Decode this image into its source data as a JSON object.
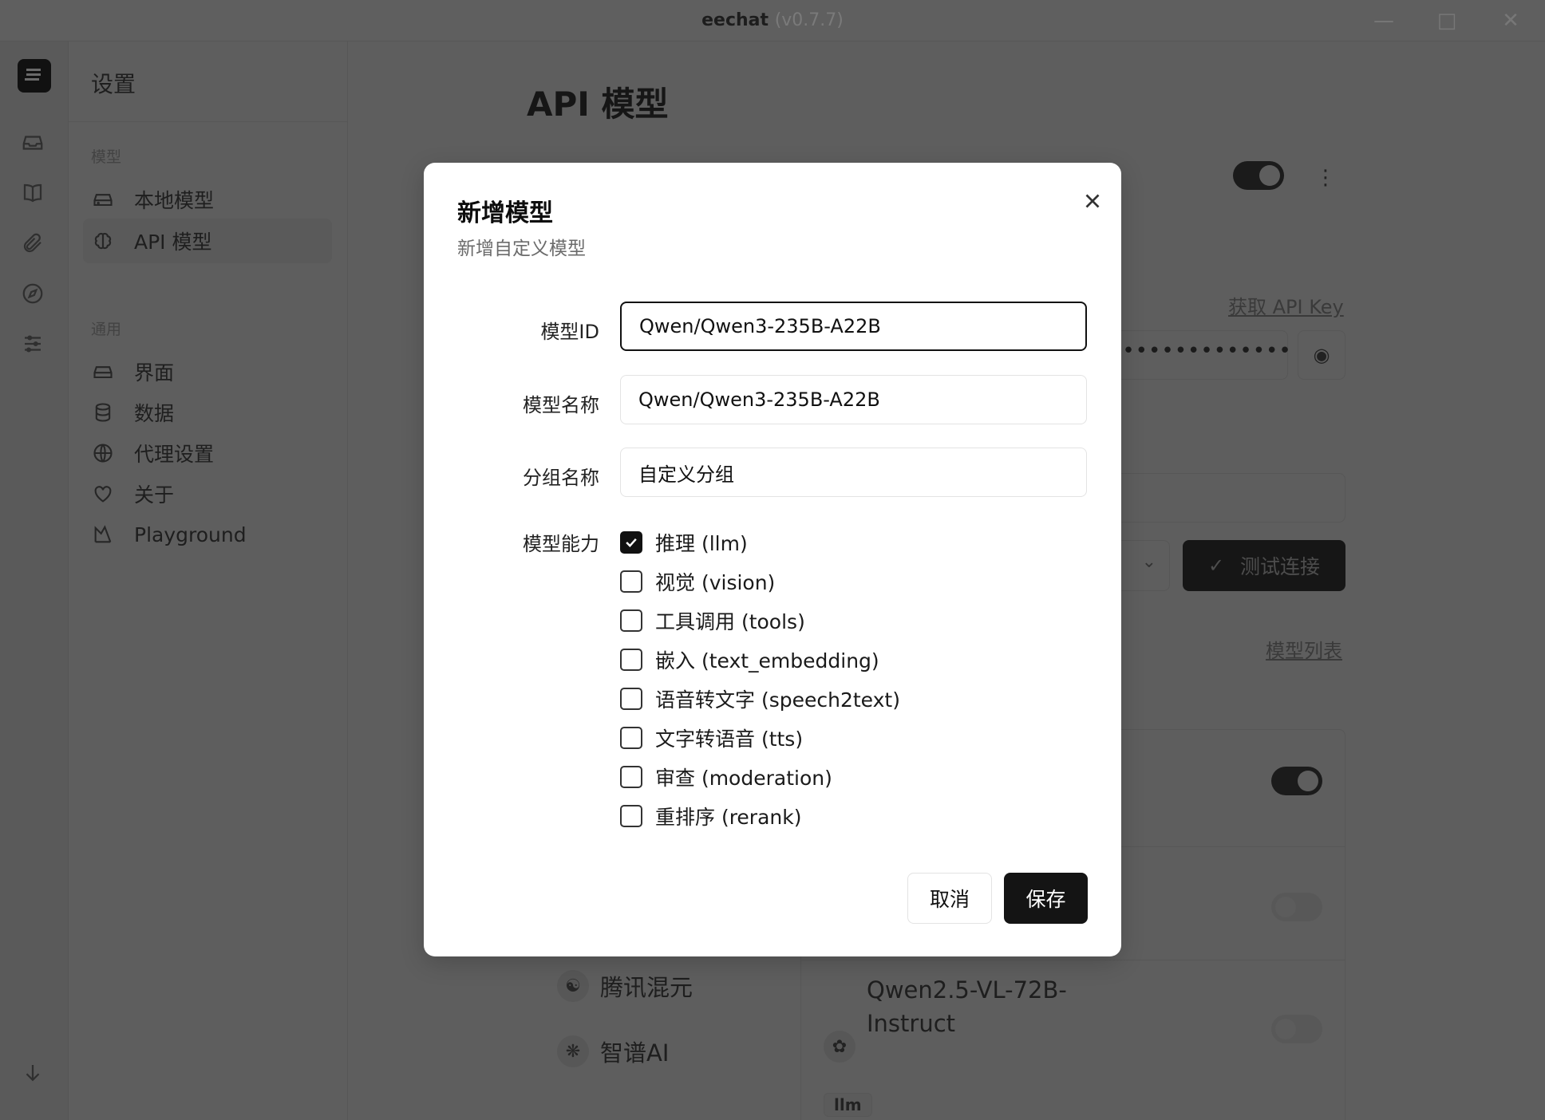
{
  "window": {
    "app_name": "eechat",
    "version": "(v0.7.7)"
  },
  "sidebar": {
    "title": "设置",
    "sections": [
      {
        "label": "模型",
        "items": [
          {
            "label": "本地模型",
            "icon": "drive-icon"
          },
          {
            "label": "API 模型",
            "icon": "brain-icon",
            "active": true
          }
        ]
      },
      {
        "label": "通用",
        "items": [
          {
            "label": "界面",
            "icon": "drive-icon"
          },
          {
            "label": "数据",
            "icon": "database-icon"
          },
          {
            "label": "代理设置",
            "icon": "globe-icon"
          },
          {
            "label": "关于",
            "icon": "heart-icon"
          },
          {
            "label": "Playground",
            "icon": "playground-icon"
          }
        ]
      }
    ]
  },
  "main": {
    "title": "API 模型",
    "get_api_key_link": "获取 API Key",
    "test_connection": "测试连接",
    "model_list_link": "模型列表",
    "providers": [
      {
        "name": "腾讯混元"
      },
      {
        "name": "智谱AI"
      }
    ],
    "model_card": {
      "name": "Qwen2.5-VL-72B-Instruct",
      "badge": "llm"
    }
  },
  "dialog": {
    "title": "新增模型",
    "subtitle": "新增自定义模型",
    "fields": {
      "model_id": {
        "label": "模型ID",
        "value": "Qwen/Qwen3-235B-A22B"
      },
      "model_name": {
        "label": "模型名称",
        "value": "Qwen/Qwen3-235B-A22B"
      },
      "group_name": {
        "label": "分组名称",
        "value": "自定义分组"
      }
    },
    "capabilities_label": "模型能力",
    "capabilities": [
      {
        "label": "推理 (llm)",
        "checked": true
      },
      {
        "label": "视觉 (vision)",
        "checked": false
      },
      {
        "label": "工具调用 (tools)",
        "checked": false
      },
      {
        "label": "嵌入 (text_embedding)",
        "checked": false
      },
      {
        "label": "语音转文字 (speech2text)",
        "checked": false
      },
      {
        "label": "文字转语音 (tts)",
        "checked": false
      },
      {
        "label": "审查 (moderation)",
        "checked": false
      },
      {
        "label": "重排序 (rerank)",
        "checked": false
      }
    ],
    "cancel_label": "取消",
    "save_label": "保存"
  },
  "colors": {
    "overlay": "#5e5e5e",
    "primary": "#141414",
    "dialog_bg": "#ffffff"
  }
}
